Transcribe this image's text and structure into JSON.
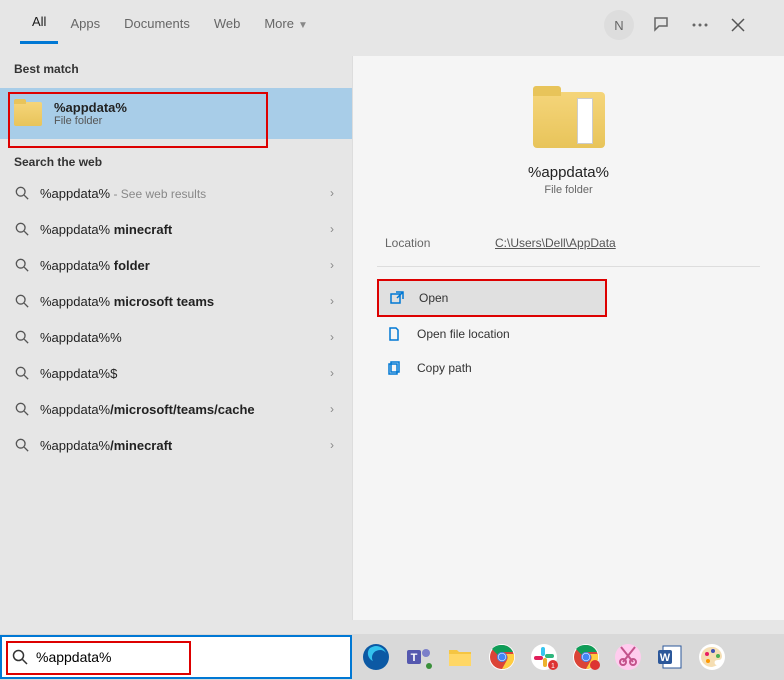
{
  "tabs": {
    "items": [
      "All",
      "Apps",
      "Documents",
      "Web",
      "More"
    ],
    "active_index": 0,
    "more_has_dropdown": true
  },
  "header": {
    "avatar_initial": "N"
  },
  "sections": {
    "best_match": "Best match",
    "search_web": "Search the web"
  },
  "best_match": {
    "title": "%appdata%",
    "subtitle": "File folder"
  },
  "web_results": [
    {
      "text": "%appdata%",
      "hint": " - See web results",
      "bold": false
    },
    {
      "text": "%appdata% minecraft",
      "hint": "",
      "bold": true
    },
    {
      "text": "%appdata% folder",
      "hint": "",
      "bold": true
    },
    {
      "text": "%appdata% microsoft teams",
      "hint": "",
      "bold": true
    },
    {
      "text": "%appdata%%",
      "hint": "",
      "bold": false
    },
    {
      "text": "%appdata%$",
      "hint": "",
      "bold": false
    },
    {
      "text": "%appdata%/microsoft/teams/cache",
      "hint": "",
      "bold": true
    },
    {
      "text": "%appdata%/minecraft",
      "hint": "",
      "bold": true
    }
  ],
  "preview": {
    "title": "%appdata%",
    "subtitle": "File folder",
    "location_label": "Location",
    "location_value": "C:\\Users\\Dell\\AppData",
    "actions": [
      {
        "label": "Open",
        "icon": "open",
        "highlighted": true
      },
      {
        "label": "Open file location",
        "icon": "file-location",
        "highlighted": false
      },
      {
        "label": "Copy path",
        "icon": "copy",
        "highlighted": false
      }
    ]
  },
  "search": {
    "value": "%appdata%"
  },
  "taskbar_apps": [
    {
      "name": "edge",
      "color": "#0078d4"
    },
    {
      "name": "teams",
      "color": "#5558af"
    },
    {
      "name": "explorer",
      "color": "#f5c542"
    },
    {
      "name": "chrome",
      "color": "#fff"
    },
    {
      "name": "slack",
      "color": "#4a154b"
    },
    {
      "name": "chrome-2",
      "color": "#fff"
    },
    {
      "name": "snip",
      "color": "#e91e63"
    },
    {
      "name": "word",
      "color": "#2b579a"
    },
    {
      "name": "paint",
      "color": "#fff"
    }
  ]
}
